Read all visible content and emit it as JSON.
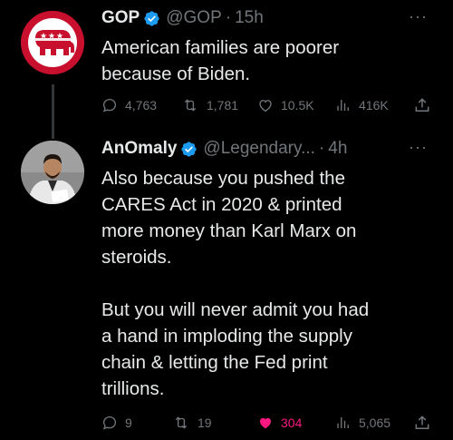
{
  "tweets": [
    {
      "name": "GOP",
      "handle": "@GOP",
      "time": "15h",
      "text": "American families are poorer\nbecause of Biden.",
      "avatar_icon": "republican-elephant-logo-icon",
      "stats": {
        "replies": "4,763",
        "retweets": "1,781",
        "likes": "10.5K",
        "views": "416K"
      }
    },
    {
      "name": "AnOmaly",
      "handle": "@Legendary...",
      "time": "4h",
      "text": "Also because you pushed the\nCARES Act in 2020 & printed\nmore money than Karl Marx on\nsteroids.\n\nBut you will never admit you had\na hand in imploding the supply\nchain & letting the Fed print\ntrillions.",
      "avatar_icon": "user-photo-avatar",
      "stats": {
        "replies": "9",
        "retweets": "19",
        "likes": "304",
        "views": "5,065"
      },
      "liked": true
    }
  ],
  "colors": {
    "background": "#000000",
    "text": "#e7e9ea",
    "muted": "#71767b",
    "verified": "#1d9bf0",
    "like": "#f91880",
    "gop_red": "#c8102e"
  }
}
